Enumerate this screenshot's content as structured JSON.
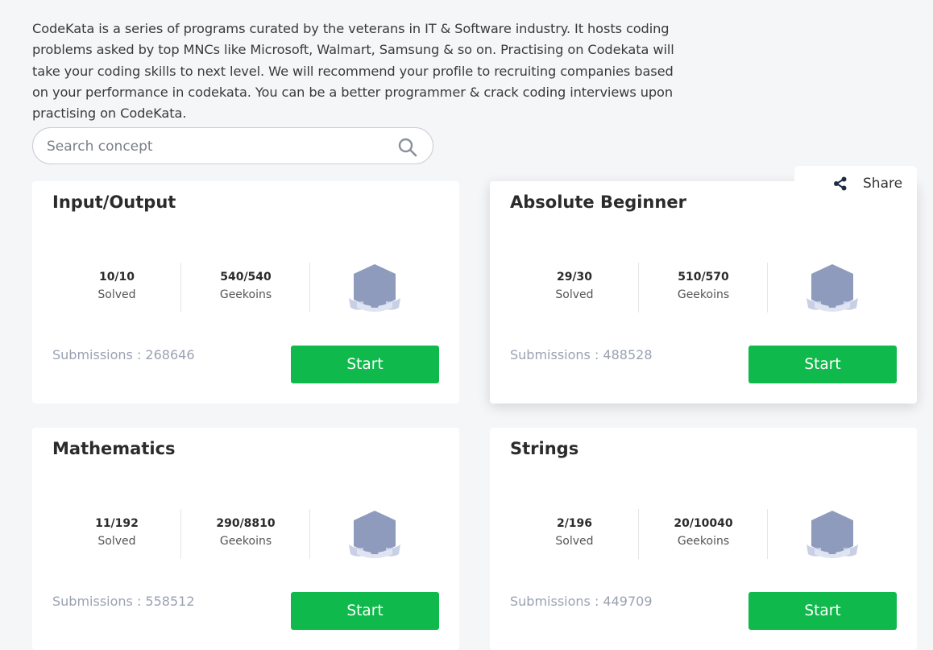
{
  "intro": "CodeKata is a series of programs curated by the veterans in IT & Software industry. It hosts coding problems asked by top MNCs like Microsoft, Walmart, Samsung & so on. Practising on Codekata will take your coding skills to next level. We will recommend your profile to recruiting companies based on your performance in codekata. You can be a better programmer & crack coding interviews upon practising on CodeKata.",
  "search": {
    "placeholder": "Search concept",
    "icon": "search-icon"
  },
  "share": {
    "label": "Share",
    "icon": "share-icon"
  },
  "colors": {
    "start_button": "#10b94c",
    "badge": "#8f9bbd",
    "background": "#f5f6f8"
  },
  "cards": [
    {
      "title": "Input/Output",
      "solved": "10/10",
      "solved_label": "Solved",
      "geekoins": "540/540",
      "geekoins_label": "Geekoins",
      "submissions": "Submissions : 268646",
      "button": "Start"
    },
    {
      "title": "Absolute Beginner",
      "solved": "29/30",
      "solved_label": "Solved",
      "geekoins": "510/570",
      "geekoins_label": "Geekoins",
      "submissions": "Submissions : 488528",
      "button": "Start"
    },
    {
      "title": "Mathematics",
      "solved": "11/192",
      "solved_label": "Solved",
      "geekoins": "290/8810",
      "geekoins_label": "Geekoins",
      "submissions": "Submissions : 558512",
      "button": "Start"
    },
    {
      "title": "Strings",
      "solved": "2/196",
      "solved_label": "Solved",
      "geekoins": "20/10040",
      "geekoins_label": "Geekoins",
      "submissions": "Submissions : 449709",
      "button": "Start"
    }
  ]
}
